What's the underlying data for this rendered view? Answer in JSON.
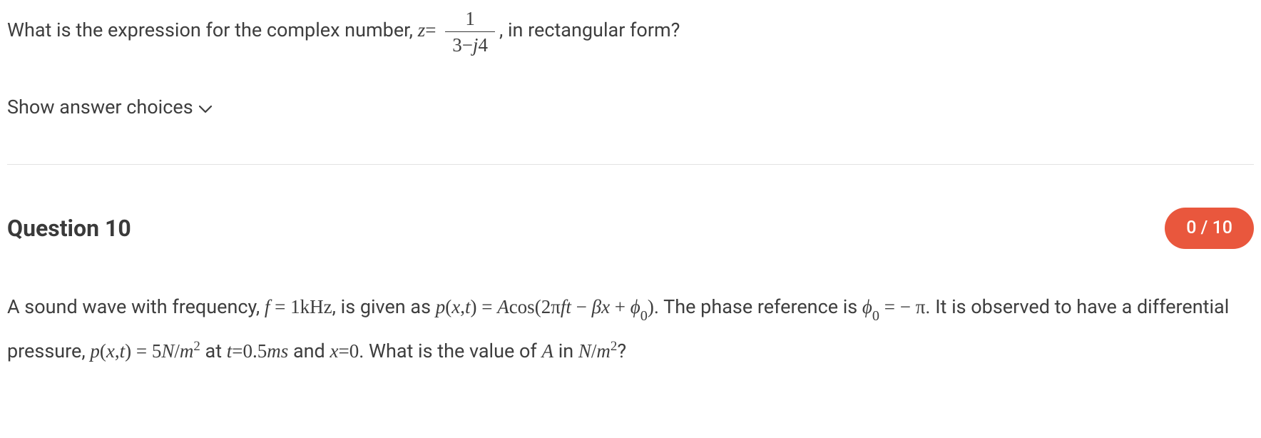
{
  "q9": {
    "text_before": "What is the expression for the complex number, ",
    "z_eq": "z",
    "frac_num": "1",
    "frac_den_a": "3",
    "frac_den_minus": "−",
    "frac_den_j": "j",
    "frac_den_b": "4",
    "text_after": ", in rectangular form?",
    "show_choices": "Show answer choices"
  },
  "q10": {
    "heading": "Question 10",
    "score": "0 / 10",
    "t1": "A sound wave with frequency, ",
    "f_eq": "f",
    "equals1": " = ",
    "onekhz": "1kHz",
    "t2": ", is given as ",
    "p_xt": "p",
    "p_args_open": "(",
    "x": "x",
    "comma1": ",",
    "t": "t",
    "p_args_close": ")",
    "eq1": " = ",
    "A": "A",
    "cos": "cos",
    "paren_open": "(",
    "two": "2",
    "pi": "π",
    "f2": "f",
    "t2v": "t",
    "minus1": " − ",
    "beta": "β",
    "x2": "x",
    "plus1": " + ",
    "phi": "ϕ",
    "sub0": "0",
    "paren_close": ")",
    "t3": ". The phase reference is ",
    "phi2": "ϕ",
    "sub0b": "0",
    "eq2": " = − ",
    "pi2": "π",
    "t4": ". It is observed to have a differential pressure, ",
    "p2": "p",
    "p2_open": "(",
    "x3": "x",
    "comma2": ",",
    "t3v": "t",
    "p2_close": ")",
    "eq3": " = ",
    "five": "5",
    "N": "N",
    "slash1": "/",
    "m": "m",
    "sup2": "2",
    "at": " at ",
    "t_eq": "t",
    "eq4": "=",
    "halfms": "0.5",
    "ms": "ms",
    "and": " and ",
    "x_eq": "x",
    "eq5": "=",
    "zero": "0",
    "t5": ". What is the value of ",
    "A2": "A",
    "in": " in ",
    "N2": "N",
    "slash2": "/",
    "m2": "m",
    "sup2b": "2",
    "qmark": "?"
  }
}
